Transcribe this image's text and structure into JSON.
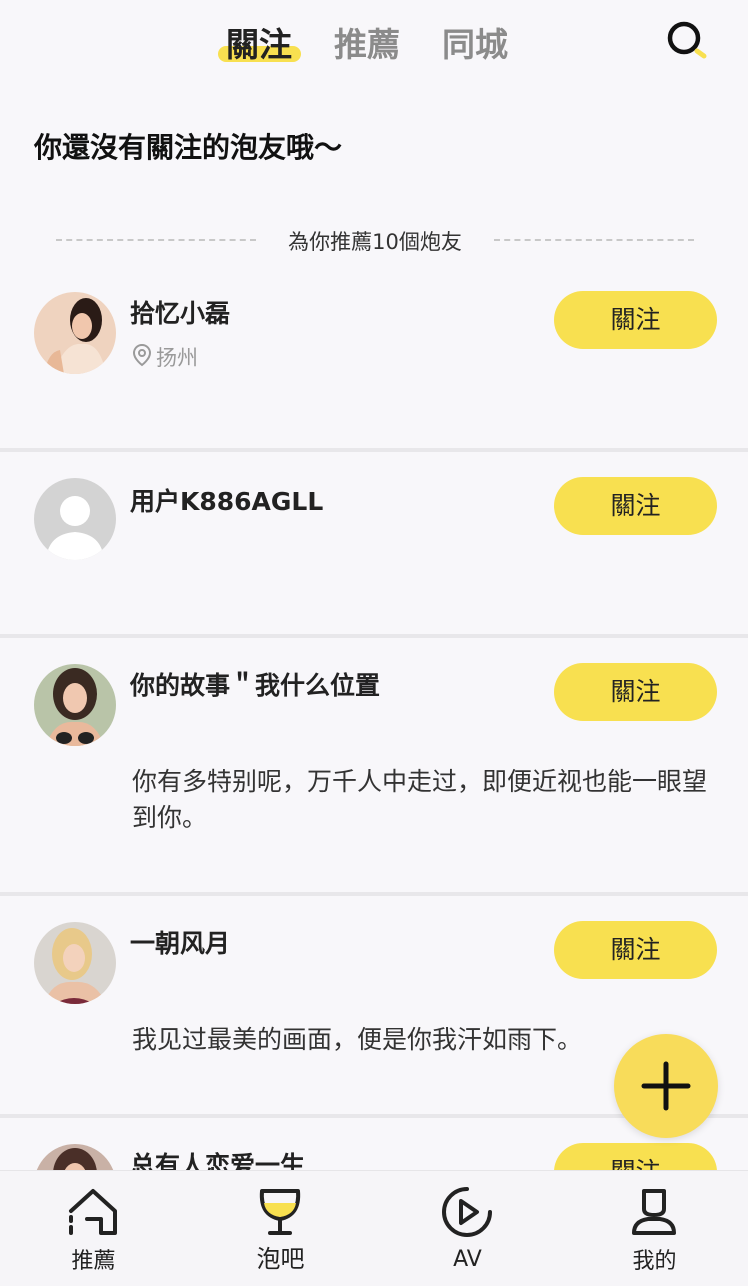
{
  "header": {
    "tabs": [
      {
        "label": "關注",
        "active": true
      },
      {
        "label": "推薦",
        "active": false
      },
      {
        "label": "同城",
        "active": false
      }
    ],
    "search_icon": "search-icon"
  },
  "empty_message": "你還沒有關注的泡友哦～",
  "recommend_divider": "為你推薦10個炮友",
  "users": [
    {
      "name": "拾忆小磊",
      "location": "扬州",
      "bio": "",
      "follow_label": "關注",
      "avatar": "photo"
    },
    {
      "name": "用户K886AGLL",
      "location": "",
      "bio": "",
      "follow_label": "關注",
      "avatar": "default-avatar"
    },
    {
      "name": "你的故事＂我什么位置",
      "location": "",
      "bio": "你有多特别呢，万千人中走过，即便近视也能一眼望到你。",
      "follow_label": "關注",
      "avatar": "photo"
    },
    {
      "name": "一朝风月",
      "location": "",
      "bio": "我见过最美的画面，便是你我汗如雨下。",
      "follow_label": "關注",
      "avatar": "photo"
    },
    {
      "name": "总有人恋爱一生",
      "location": "",
      "bio": "",
      "follow_label": "關注",
      "avatar": "photo"
    }
  ],
  "fab_icon": "plus-icon",
  "bottom_nav": [
    {
      "label": "推薦",
      "icon": "home-icon",
      "active": false
    },
    {
      "label": "泡吧",
      "icon": "wine-glass-icon",
      "active": true
    },
    {
      "label": "AV",
      "icon": "play-icon",
      "active": false
    },
    {
      "label": "我的",
      "icon": "profile-icon",
      "active": false
    }
  ],
  "colors": {
    "accent": "#f8e050",
    "background": "#f8f7fa",
    "text": "#222222",
    "muted": "#9a9a9a"
  }
}
